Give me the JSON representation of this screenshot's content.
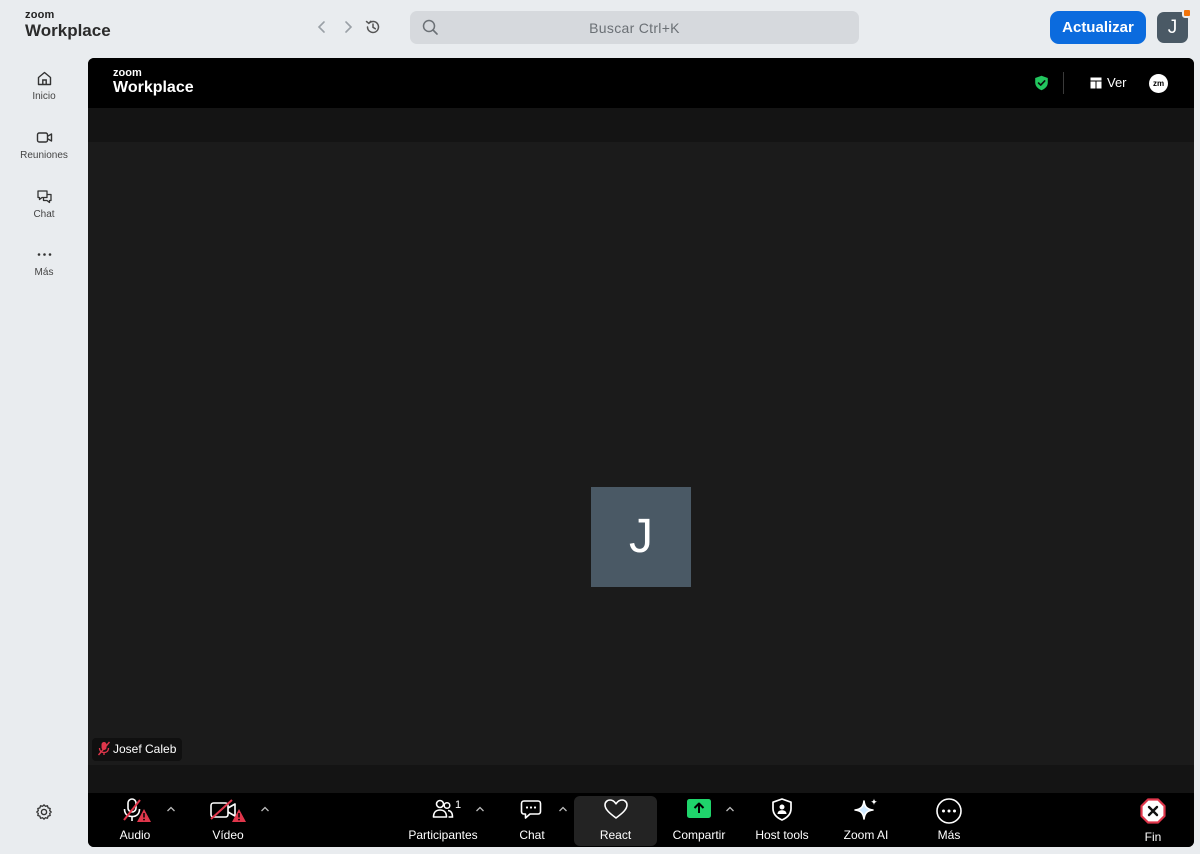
{
  "app": {
    "brand_small": "zoom",
    "brand_large": "Workplace"
  },
  "topbar": {
    "search_placeholder": "Buscar Ctrl+K",
    "update_label": "Actualizar",
    "avatar_initial": "J",
    "accent_color": "#0b6bde"
  },
  "sidebar": {
    "items": [
      {
        "label": "Inicio",
        "icon": "home-icon"
      },
      {
        "label": "Reuniones",
        "icon": "video-icon"
      },
      {
        "label": "Chat",
        "icon": "chat-icon"
      },
      {
        "label": "Más",
        "icon": "more-icon"
      }
    ],
    "settings_icon": "gear-icon"
  },
  "meeting": {
    "brand_small": "zoom",
    "brand_large": "Workplace",
    "view_label": "Ver",
    "zm_badge": "zm",
    "participant_initial": "J",
    "participant_name": "Josef Caleb"
  },
  "toolbar": {
    "audio_label": "Audio",
    "video_label": "Vídeo",
    "participants_label": "Participantes",
    "participants_count": "1",
    "chat_label": "Chat",
    "react_label": "React",
    "share_label": "Compartir",
    "host_tools_label": "Host tools",
    "zoom_ai_label": "Zoom AI",
    "more_label": "Más",
    "end_label": "Fin",
    "share_color": "#1fd46b",
    "end_color": "#e0364b"
  }
}
